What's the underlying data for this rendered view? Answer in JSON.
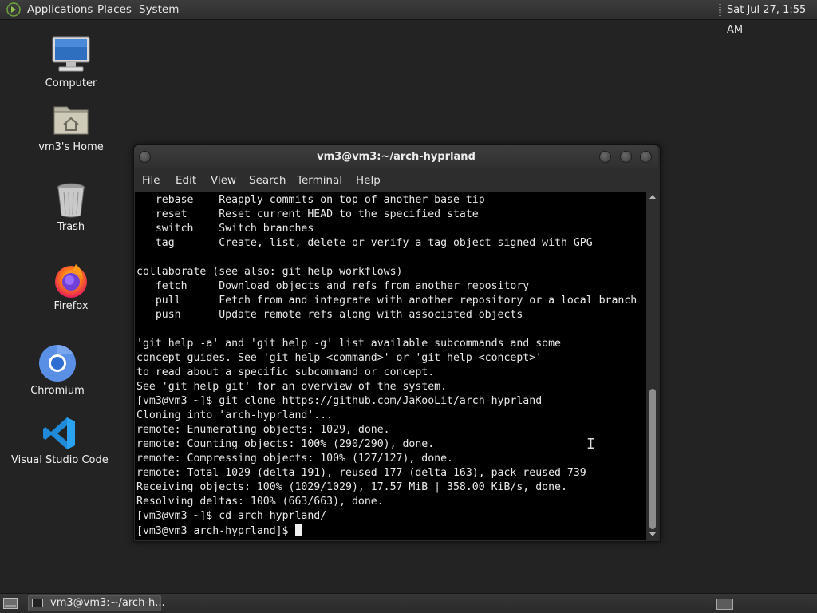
{
  "top_panel": {
    "menus": [
      "Applications",
      "Places",
      "System"
    ],
    "clock": "Sat Jul 27,  1:55 AM",
    "logo_icon": "mate-foot-logo-icon"
  },
  "desktop_icons": [
    {
      "label": "Computer",
      "icon": "computer-icon"
    },
    {
      "label": "vm3's Home",
      "icon": "home-folder-icon"
    },
    {
      "label": "Trash",
      "icon": "trash-icon"
    },
    {
      "label": "Firefox",
      "icon": "firefox-icon"
    },
    {
      "label": "Chromium",
      "icon": "chromium-icon"
    },
    {
      "label": "Visual Studio Code",
      "icon": "vscode-icon"
    }
  ],
  "terminal": {
    "title": "vm3@vm3:~/arch-hyprland",
    "menu": [
      "File",
      "Edit",
      "View",
      "Search",
      "Terminal",
      "Help"
    ],
    "lines": [
      "   rebase    Reapply commits on top of another base tip",
      "   reset     Reset current HEAD to the specified state",
      "   switch    Switch branches",
      "   tag       Create, list, delete or verify a tag object signed with GPG",
      "",
      "collaborate (see also: git help workflows)",
      "   fetch     Download objects and refs from another repository",
      "   pull      Fetch from and integrate with another repository or a local branch",
      "   push      Update remote refs along with associated objects",
      "",
      "'git help -a' and 'git help -g' list available subcommands and some",
      "concept guides. See 'git help <command>' or 'git help <concept>'",
      "to read about a specific subcommand or concept.",
      "See 'git help git' for an overview of the system.",
      "[vm3@vm3 ~]$ git clone https://github.com/JaKooLit/arch-hyprland",
      "Cloning into 'arch-hyprland'...",
      "remote: Enumerating objects: 1029, done.",
      "remote: Counting objects: 100% (290/290), done.",
      "remote: Compressing objects: 100% (127/127), done.",
      "remote: Total 1029 (delta 191), reused 177 (delta 163), pack-reused 739",
      "Receiving objects: 100% (1029/1029), 17.57 MiB | 358.00 KiB/s, done.",
      "Resolving deltas: 100% (663/663), done.",
      "[vm3@vm3 ~]$ cd arch-hyprland/"
    ],
    "prompt": "[vm3@vm3 arch-hyprland]$ "
  },
  "taskbar": {
    "task_label": "vm3@vm3:~/arch-h..."
  },
  "colors": {
    "desktop_bg": "#232323",
    "terminal_bg": "#000000",
    "terminal_fg": "#e8e8e8",
    "panel_bg": "#363636"
  }
}
